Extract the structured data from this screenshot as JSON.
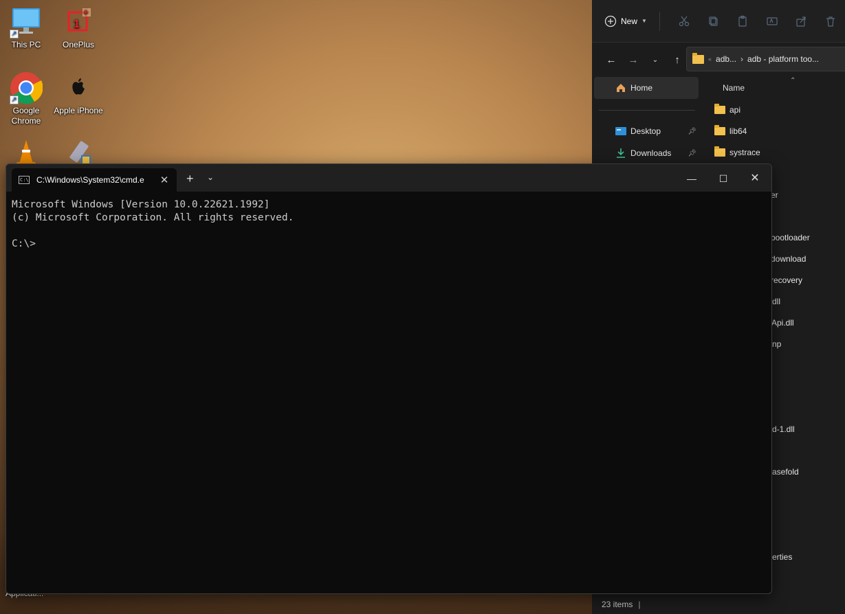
{
  "desktop": {
    "icons": [
      {
        "label": "This PC",
        "icon": "this-pc-icon"
      },
      {
        "label": "OnePlus",
        "icon": "oneplus-icon"
      },
      {
        "label": "Google Chrome",
        "icon": "chrome-icon"
      },
      {
        "label": "Apple iPhone",
        "icon": "apple-icon"
      }
    ],
    "partial_label": "Applicati..."
  },
  "explorer": {
    "new_label": "New",
    "address": {
      "part1": "adb...",
      "part2": "adb - platform too..."
    },
    "sidebar": [
      {
        "label": "Home",
        "icon": "home-icon"
      },
      {
        "label": "Desktop",
        "icon": "desktop-folder-icon"
      },
      {
        "label": "Downloads",
        "icon": "downloads-icon"
      }
    ],
    "column_name": "Name",
    "folders": [
      "api",
      "lib64",
      "systrace"
    ],
    "partial_files": [
      "er",
      "bootloader",
      "download",
      "recovery",
      "dll",
      "Api.dll",
      "np",
      "d-1.dll",
      "asefold",
      "erties"
    ],
    "status": "23 items"
  },
  "terminal": {
    "tab_title": "C:\\Windows\\System32\\cmd.e",
    "lines": [
      "Microsoft Windows [Version 10.0.22621.1992]",
      "(c) Microsoft Corporation. All rights reserved.",
      "",
      "C:\\>"
    ]
  }
}
